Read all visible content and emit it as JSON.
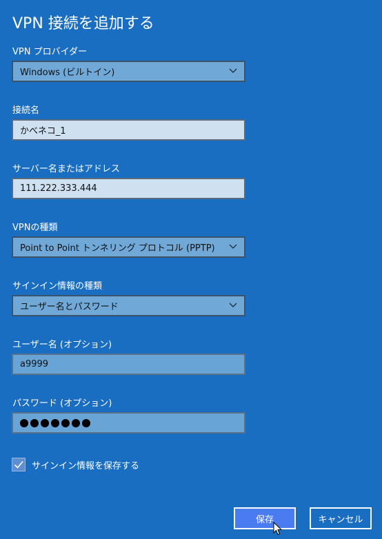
{
  "dialog": {
    "title": "VPN 接続を追加する"
  },
  "fields": {
    "provider": {
      "label": "VPN プロバイダー",
      "value": "Windows (ビルトイン)"
    },
    "connection_name": {
      "label": "接続名",
      "value": "かべネコ_1"
    },
    "server": {
      "label": "サーバー名またはアドレス",
      "value": "111.222.333.444"
    },
    "vpn_type": {
      "label": "VPNの種類",
      "value": "Point to Point トンネリング プロトコル (PPTP)"
    },
    "signin_type": {
      "label": "サインイン情報の種類",
      "value": "ユーザー名とパスワード"
    },
    "username": {
      "label": "ユーザー名 (オプション)",
      "value": "a9999"
    },
    "password": {
      "label": "パスワード (オプション)",
      "masked_length": 7
    }
  },
  "remember": {
    "label": "サインイン情報を保存する",
    "checked": true
  },
  "buttons": {
    "save": "保存",
    "cancel": "キャンセル"
  },
  "colors": {
    "background": "#1a6ec2",
    "save_button": "#4a7bf0"
  },
  "icons": {
    "dropdown": "chevron-down-icon",
    "checkbox": "check-icon",
    "cursor": "mouse-pointer-icon"
  }
}
